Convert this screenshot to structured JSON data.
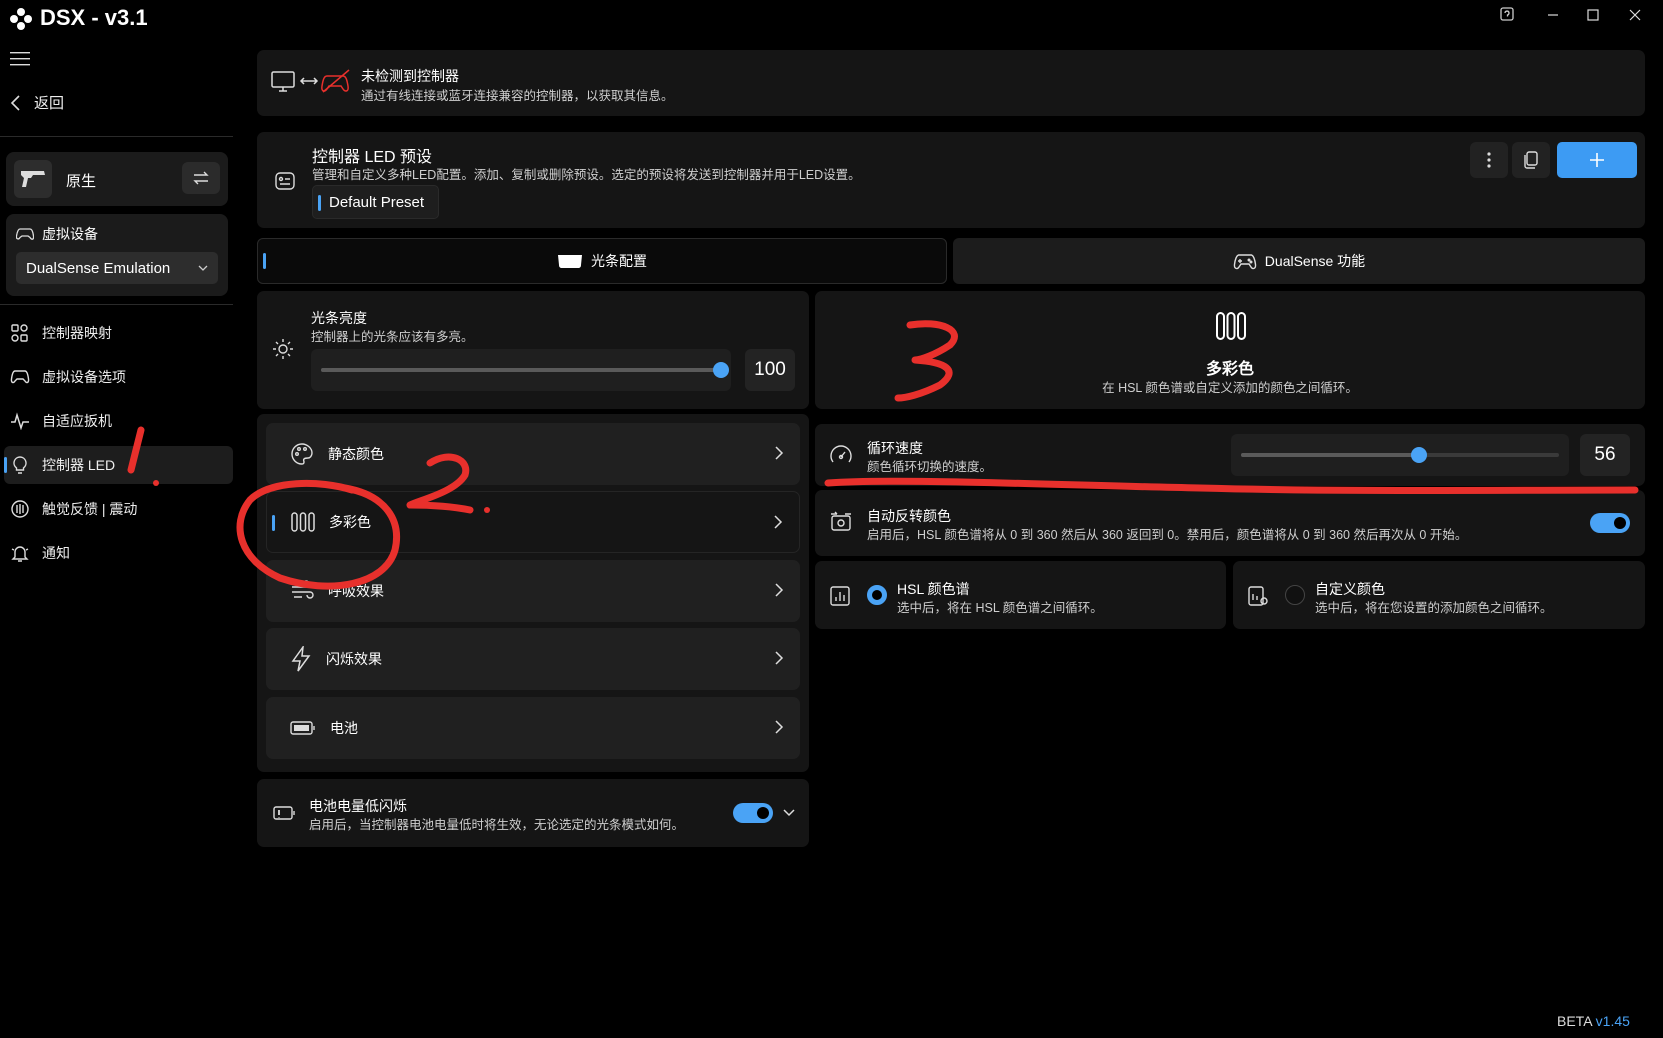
{
  "app": {
    "title": "DSX - v3.1",
    "version_prefix": "BETA",
    "version": "v1.45"
  },
  "sidebar": {
    "back_label": "返回",
    "profile_label": "原生",
    "virtual_device_label": "虚拟设备",
    "virtual_device_value": "DualSense Emulation",
    "items": [
      {
        "label": "控制器映射",
        "icon": "grid-icon"
      },
      {
        "label": "虚拟设备选项",
        "icon": "gamepad-icon"
      },
      {
        "label": "自适应扳机",
        "icon": "pulse-icon"
      },
      {
        "label": "控制器 LED",
        "icon": "bulb-icon",
        "active": true
      },
      {
        "label": "触觉反馈 | 震动",
        "icon": "vibration-icon"
      },
      {
        "label": "通知",
        "icon": "bell-icon"
      }
    ]
  },
  "status": {
    "title": "未检测到控制器",
    "subtitle": "通过有线连接或蓝牙连接兼容的控制器，以获取其信息。"
  },
  "preset": {
    "title": "控制器 LED 预设",
    "subtitle": "管理和自定义多种LED配置。添加、复制或删除预设。选定的预设将发送到控制器并用于LED设置。",
    "chip": "Default Preset"
  },
  "tabs": [
    {
      "label": "光条配置",
      "active": true
    },
    {
      "label": "DualSense 功能",
      "active": false
    }
  ],
  "brightness": {
    "title": "光条亮度",
    "subtitle": "控制器上的光条应该有多亮。",
    "value": "100",
    "level": 1.0
  },
  "modes": [
    {
      "label": "静态颜色",
      "icon": "palette-icon"
    },
    {
      "label": "多彩色",
      "icon": "multicolor-icon",
      "active": true
    },
    {
      "label": "呼吸效果",
      "icon": "wind-icon"
    },
    {
      "label": "闪烁效果",
      "icon": "flash-icon"
    },
    {
      "label": "电池",
      "icon": "battery-icon"
    }
  ],
  "low_battery": {
    "title": "电池电量低闪烁",
    "subtitle": "启用后，当控制器电池电量低时将生效，无论选定的光条模式如何。",
    "enabled": true
  },
  "mode_header": {
    "title": "多彩色",
    "subtitle": "在 HSL 颜色谱或自定义添加的颜色之间循环。"
  },
  "cycle_speed": {
    "title": "循环速度",
    "subtitle": "颜色循环切换的速度。",
    "value": "56",
    "level": 0.56
  },
  "auto_reverse": {
    "title": "自动反转颜色",
    "subtitle": "启用后，HSL 颜色谱将从 0 到 360 然后从 360 返回到 0。禁用后，颜色谱将从 0 到 360 然后再次从 0 开始。",
    "enabled": true
  },
  "color_source": [
    {
      "title": "HSL 颜色谱",
      "subtitle": "选中后，将在 HSL 颜色谱之间循环。",
      "selected": true
    },
    {
      "title": "自定义颜色",
      "subtitle": "选中后，将在您设置的添加颜色之间循环。",
      "selected": false
    }
  ],
  "colors": {
    "accent": "#4aa3f5",
    "annotation": "#e8302c"
  }
}
